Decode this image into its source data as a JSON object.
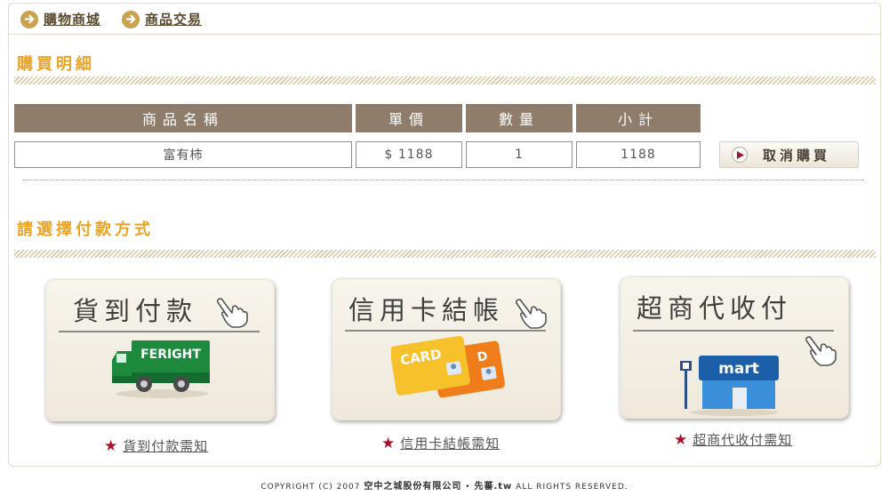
{
  "nav": {
    "items": [
      {
        "label": "購物商城"
      },
      {
        "label": "商品交易"
      }
    ]
  },
  "purchase": {
    "title": "購買明細",
    "headers": [
      "商品名稱",
      "單價",
      "數量",
      "小計"
    ],
    "row": {
      "name": "富有柿",
      "price": "$ 1188",
      "qty": "1",
      "subtotal": "1188"
    },
    "cancel_label": "取消購買"
  },
  "payment": {
    "title": "請選擇付款方式",
    "options": [
      {
        "title": "貨到付款",
        "graphic_text": "FERIGHT",
        "link": "貨到付款需知"
      },
      {
        "title": "信用卡結帳",
        "graphic_text": "CARD",
        "link": "信用卡結帳需知"
      },
      {
        "title": "超商代收付",
        "graphic_text": "mart",
        "link": "超商代收付需知"
      }
    ]
  },
  "footer": {
    "prefix": "COPYRIGHT (C) 2007",
    "company": "空中之城股份有限公司",
    "sep": "•",
    "brand": "先蕃.tw",
    "suffix": "ALL RIGHTS RESERVED."
  },
  "colors": {
    "accent": "#eaa325",
    "header_bg": "#8e7d6b",
    "nav_icon": "#c9a24f",
    "star": "#a8132b"
  }
}
